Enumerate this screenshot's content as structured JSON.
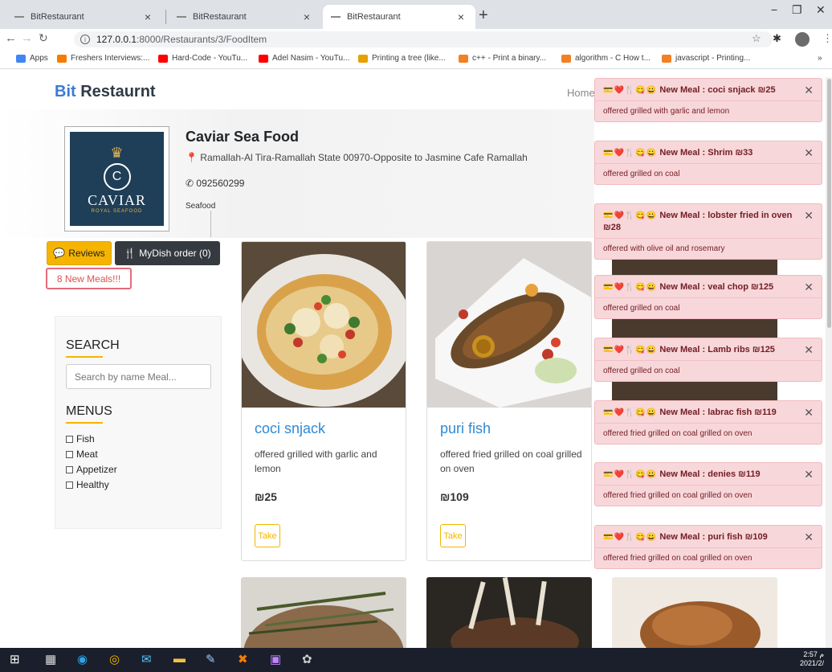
{
  "browser": {
    "tabs": [
      {
        "label": "BitRestaurant",
        "active": false
      },
      {
        "label": "BitRestaurant",
        "active": false
      },
      {
        "label": "BitRestaurant",
        "active": true
      }
    ],
    "url_host": "127.0.0.1",
    "url_path": ":8000/Restaurants/3/FoodItem",
    "bookmarks": [
      {
        "label": "Apps",
        "color": "#4285f4"
      },
      {
        "label": "Freshers Interviews:...",
        "color": "#f57c00"
      },
      {
        "label": "Hard-Code - YouTu...",
        "color": "#ff0000"
      },
      {
        "label": "Adel Nasim - YouTu...",
        "color": "#ff0000"
      },
      {
        "label": "Printing a tree (like...",
        "color": "#e6a100"
      },
      {
        "label": "c++ - Print a binary...",
        "color": "#f48024"
      },
      {
        "label": "algorithm - C How t...",
        "color": "#f48024"
      },
      {
        "label": "javascript - Printing...",
        "color": "#f48024"
      }
    ],
    "more_bookmarks": "»"
  },
  "site": {
    "brand_prefix": "Bit",
    "brand_rest": " Restaurnt",
    "home_link": "Home"
  },
  "restaurant": {
    "name": "Caviar Sea Food",
    "address": "Ramallah-Al Tira-Ramallah State 00970-Opposite to Jasmine Cafe Ramallah",
    "phone": "092560299",
    "category": "Seafood",
    "logo_name": "CAVIAR",
    "logo_sub": "ROYAL SEAFOOD"
  },
  "buttons": {
    "reviews": "Reviews",
    "mydish": "MyDish order (0)",
    "new_meals": "8 New Meals!!!"
  },
  "sidebar": {
    "search_heading": "SEARCH",
    "search_placeholder": "Search by name Meal...",
    "menus_heading": "MENUS",
    "menus": [
      "Fish",
      "Meat",
      "Appetizer",
      "Healthy"
    ]
  },
  "cards": [
    {
      "title": "coci snjack",
      "desc": "offered grilled with garlic and lemon",
      "price": "₪25",
      "take": "Take"
    },
    {
      "title": "puri fish",
      "desc": "offered fried grilled on coal grilled on oven",
      "price": "₪109",
      "take": "Take"
    }
  ],
  "toasts": [
    {
      "title": "New Meal : coci snjack ₪25",
      "body": "offered grilled with garlic and lemon"
    },
    {
      "title": "New Meal : Shrim ₪33",
      "body": "offered grilled on coal"
    },
    {
      "title": "New Meal : lobster fried in oven ₪28",
      "body": "offered with olive oil and rosemary"
    },
    {
      "title": "New Meal : veal chop ₪125",
      "body": "offered grilled on coal"
    },
    {
      "title": "New Meal : Lamb ribs ₪125",
      "body": "offered grilled on coal"
    },
    {
      "title": "New Meal : labrac fish ₪119",
      "body": "offered fried grilled on coal grilled on oven"
    },
    {
      "title": "New Meal : denies ₪119",
      "body": "offered fried grilled on coal grilled on oven"
    },
    {
      "title": "New Meal : puri fish ₪109",
      "body": "offered fried grilled on coal grilled on oven"
    }
  ],
  "taskbar": {
    "time": "2:57 م",
    "date": "2021/2/"
  }
}
